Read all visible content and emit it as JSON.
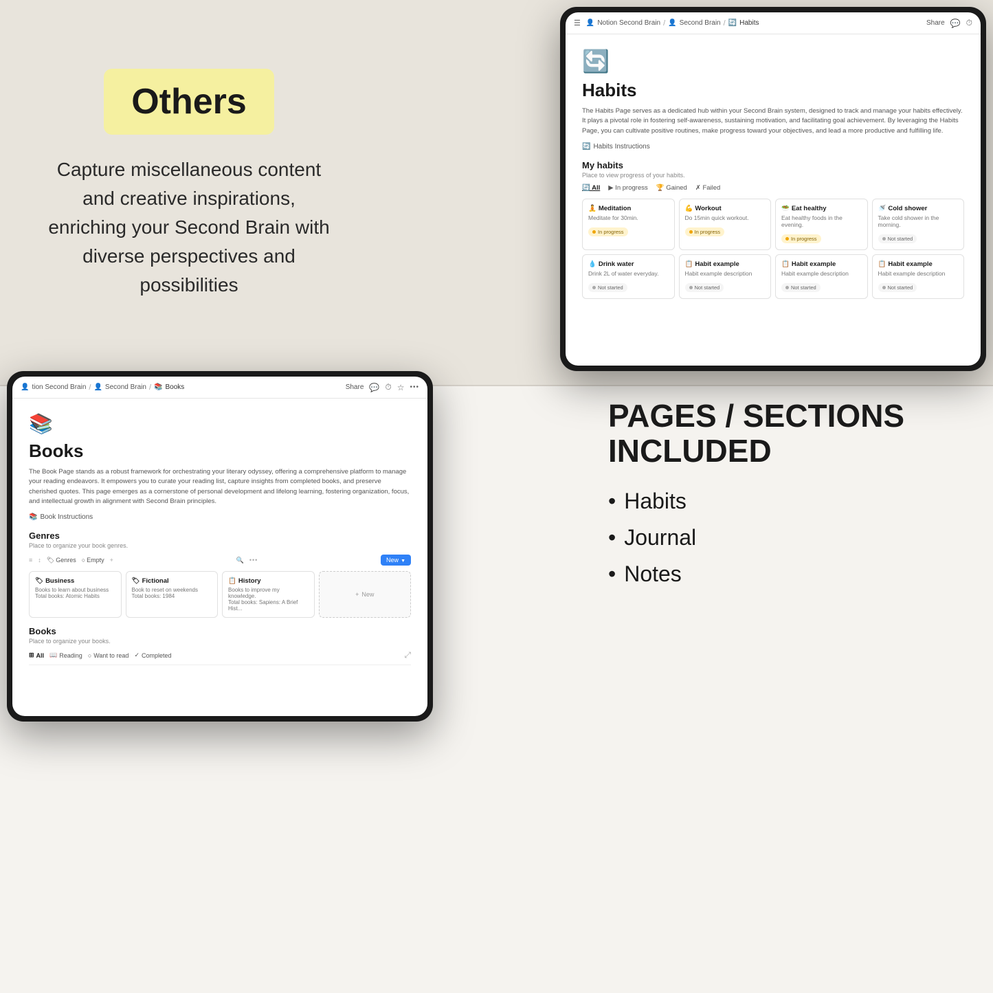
{
  "background": {
    "top_color": "#e8e4dc",
    "bottom_color": "#f5f3ef"
  },
  "left_panel": {
    "badge_text": "Others",
    "badge_bg": "#f5f0a0",
    "description": "Capture miscellaneous content and creative inspirations, enriching your Second Brain with diverse perspectives and possibilities"
  },
  "habits_tablet": {
    "header": {
      "breadcrumb": [
        "Notion Second Brain",
        "Second Brain",
        "Habits"
      ],
      "actions": [
        "Share",
        "comment-icon",
        "clock-icon"
      ]
    },
    "icon": "🔄",
    "title": "Habits",
    "description": "The Habits Page serves as a dedicated hub within your Second Brain system, designed to track and manage your habits effectively. It plays a pivotal role in fostering self-awareness, sustaining motivation, and facilitating goal achievement. By leveraging the Habits Page, you can cultivate positive routines, make progress toward your objectives, and lead a more productive and fulfilling life.",
    "instructions_link": "Habits Instructions",
    "section_title": "My habits",
    "section_sub": "Place to view progress of your habits.",
    "filters": [
      "All",
      "In progress",
      "Gained",
      "Failed"
    ],
    "habit_cards": [
      {
        "icon": "🧘",
        "title": "Meditation",
        "desc": "Meditate for 30min.",
        "status": "In progress",
        "status_type": "in-progress"
      },
      {
        "icon": "💪",
        "title": "Workout",
        "desc": "Do 15min quick workout.",
        "status": "In progress",
        "status_type": "in-progress"
      },
      {
        "icon": "🥗",
        "title": "Eat healthy",
        "desc": "Eat healthy foods in the evening.",
        "status": "In progress",
        "status_type": "in-progress"
      },
      {
        "icon": "🚿",
        "title": "Cold shower",
        "desc": "Take cold shower in the morning.",
        "status": "Not started",
        "status_type": "not-started"
      },
      {
        "icon": "💧",
        "title": "Drink water",
        "desc": "Drink 2L of water everyday.",
        "status": "Not started",
        "status_type": "not-started"
      },
      {
        "icon": "📋",
        "title": "Habit example",
        "desc": "Habit example description",
        "status": "Not started",
        "status_type": "not-started"
      },
      {
        "icon": "📋",
        "title": "Habit example",
        "desc": "Habit example description",
        "status": "Not started",
        "status_type": "not-started"
      },
      {
        "icon": "📋",
        "title": "Habit example",
        "desc": "Habit example description",
        "status": "Not started",
        "status_type": "not-started"
      }
    ]
  },
  "books_tablet": {
    "header": {
      "breadcrumb": [
        "tion Second Brain",
        "Second Brain",
        "Books"
      ],
      "actions": [
        "Share",
        "comment-icon",
        "clock-icon",
        "star-icon",
        "more-icon"
      ]
    },
    "icon": "📚",
    "title": "Books",
    "description": "The Book Page stands as a robust framework for orchestrating your literary odyssey, offering a comprehensive platform to manage your reading endeavors. It empowers you to curate your reading list, capture insights from completed books, and preserve cherished quotes. This page emerges as a cornerstone of personal development and lifelong learning, fostering organization, focus, and intellectual growth in alignment with Second Brain principles.",
    "instructions_link": "Book Instructions",
    "genres_title": "Genres",
    "genres_sub": "Place to organize your book genres.",
    "genre_filters": [
      "Genres",
      "Empty"
    ],
    "new_button": "New",
    "genre_cards": [
      {
        "icon": "🏷",
        "title": "Business",
        "desc": "Books to learn about business",
        "total": "Total books: Atomic Habits"
      },
      {
        "icon": "🏷",
        "title": "Fictional",
        "desc": "Book to reset on weekends",
        "total": "Total books: 1984"
      },
      {
        "icon": "📋",
        "title": "History",
        "desc": "Books to improve my knowledge.",
        "total": "Total books: Sapiens: A Brief Hist..."
      }
    ],
    "books_section_title": "Books",
    "books_section_sub": "Place to organize your books.",
    "books_filters": [
      "All",
      "Reading",
      "Want to read",
      "Completed"
    ]
  },
  "right_panel": {
    "title": "PAGES / SECTIONS INCLUDED",
    "items": [
      "Habits",
      "Journal",
      "Notes"
    ]
  }
}
